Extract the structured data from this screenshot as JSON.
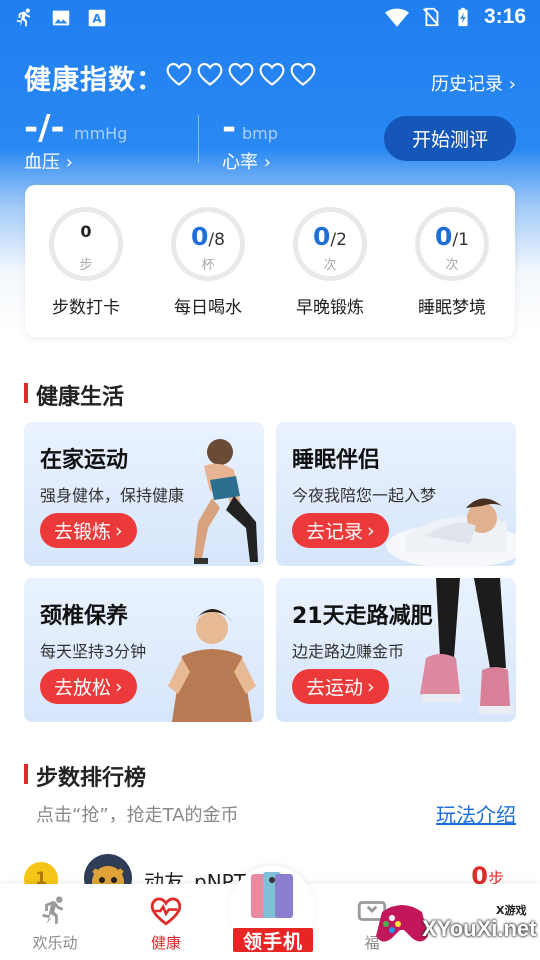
{
  "status_bar": {
    "time": "3:16",
    "left_icons": [
      "runner-icon",
      "image-icon",
      "font-icon"
    ],
    "right_icons": [
      "wifi-icon",
      "no-sim-icon",
      "battery-charging-icon"
    ]
  },
  "header": {
    "title": "健康指数：",
    "hearts_filled": 0,
    "hearts_total": 5,
    "history_label": "历史记录",
    "blood_pressure": {
      "value": "-/-",
      "unit": "mmHg",
      "label": "血压"
    },
    "heart_rate": {
      "value": "-",
      "unit": "bmp",
      "label": "心率"
    },
    "start_button": "开始测评"
  },
  "stats": [
    {
      "value": "0",
      "total": "",
      "unit": "步",
      "label": "步数打卡"
    },
    {
      "value": "0",
      "total": "/8",
      "unit": "杯",
      "label": "每日喝水"
    },
    {
      "value": "0",
      "total": "/2",
      "unit": "次",
      "label": "早晚锻炼"
    },
    {
      "value": "0",
      "total": "/1",
      "unit": "次",
      "label": "睡眠梦境"
    }
  ],
  "healthy_life": {
    "title": "健康生活",
    "tiles": [
      {
        "title": "在家运动",
        "subtitle": "强身健体，保持健康",
        "button": "去锻炼"
      },
      {
        "title": "睡眠伴侣",
        "subtitle": "今夜我陪您一起入梦",
        "button": "去记录"
      },
      {
        "title": "颈椎保养",
        "subtitle": "每天坚持3分钟",
        "button": "去放松"
      },
      {
        "title": "21天走路减肥",
        "subtitle": "边走路边赚金币",
        "button": "去运动"
      }
    ]
  },
  "ranking": {
    "title": "步数排行榜",
    "subtitle": "点击“抢”，抢走TA的金币",
    "rules_link": "玩法介绍",
    "rows": [
      {
        "rank": "1",
        "name": "动友_pNPT",
        "steps": "0",
        "unit": "步"
      }
    ]
  },
  "bottom_nav": {
    "items": [
      {
        "label": "欢乐动",
        "icon": "runner-icon"
      },
      {
        "label": "健康",
        "icon": "heart-pulse-icon"
      },
      {
        "label": "福",
        "icon": "ticket-icon"
      }
    ],
    "promo_label": "领手机"
  },
  "watermark": {
    "text": "XYouXi.net",
    "small": "X游戏"
  },
  "colors": {
    "primary": "#1f7ff0",
    "accent_red": "#e02b2b",
    "button_dark": "#1557b8"
  }
}
